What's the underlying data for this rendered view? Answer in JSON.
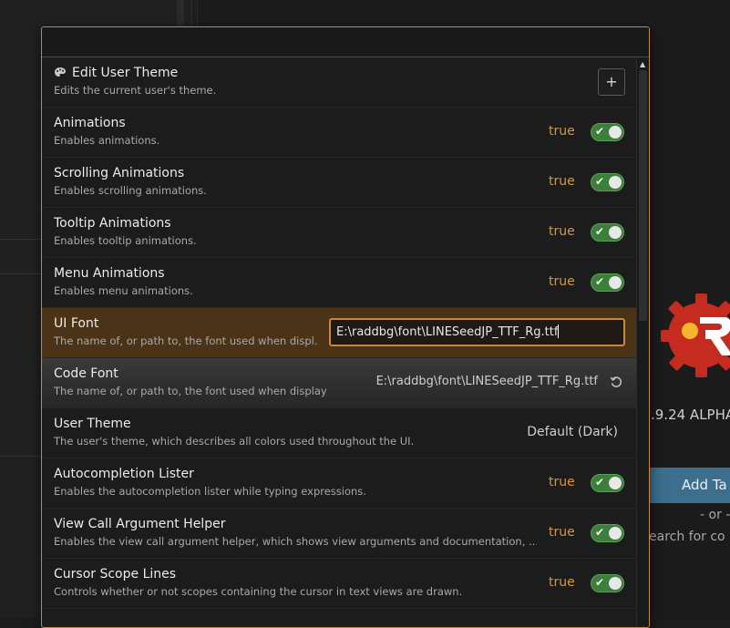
{
  "background": {
    "version_text": ".9.24 ALPHA",
    "add_target_label": "Add Ta",
    "or_label": "- or -",
    "search_label": "earch for co"
  },
  "settings": [
    {
      "title": "Edit User Theme",
      "desc": "Edits the current user's theme.",
      "control": "plus",
      "icon": "palette-icon"
    },
    {
      "title": "Animations",
      "desc": "Enables animations.",
      "control": "bool",
      "value": "true"
    },
    {
      "title": "Scrolling Animations",
      "desc": "Enables scrolling animations.",
      "control": "bool",
      "value": "true"
    },
    {
      "title": "Tooltip Animations",
      "desc": "Enables tooltip animations.",
      "control": "bool",
      "value": "true"
    },
    {
      "title": "Menu Animations",
      "desc": "Enables menu animations.",
      "control": "bool",
      "value": "true"
    },
    {
      "title": "UI Font",
      "desc": "The name of, or path to, the font used when displ...",
      "control": "input",
      "value": "E:\\raddbg\\font\\LINESeedJP_TTF_Rg.ttf"
    },
    {
      "title": "Code Font",
      "desc": "The name of, or path to, the font used when displayi...",
      "control": "path",
      "value": "E:\\raddbg\\font\\LINESeedJP_TTF_Rg.ttf"
    },
    {
      "title": "User Theme",
      "desc": "The user's theme, which describes all colors used throughout the UI.",
      "control": "text",
      "value": "Default (Dark)"
    },
    {
      "title": "Autocompletion Lister",
      "desc": "Enables the autocompletion lister while typing expressions.",
      "control": "bool",
      "value": "true"
    },
    {
      "title": "View Call Argument Helper",
      "desc": "Enables the view call argument helper, which shows view arguments and documentation, ...",
      "control": "bool",
      "value": "true"
    },
    {
      "title": "Cursor Scope Lines",
      "desc": "Controls whether or not scopes containing the cursor in text views are drawn.",
      "control": "bool",
      "value": "true"
    }
  ],
  "colors": {
    "accent": "#c8883a",
    "toggle_on": "#3c7f3a",
    "bool_text": "#d39a3c",
    "focused_row": "#4a3317"
  }
}
